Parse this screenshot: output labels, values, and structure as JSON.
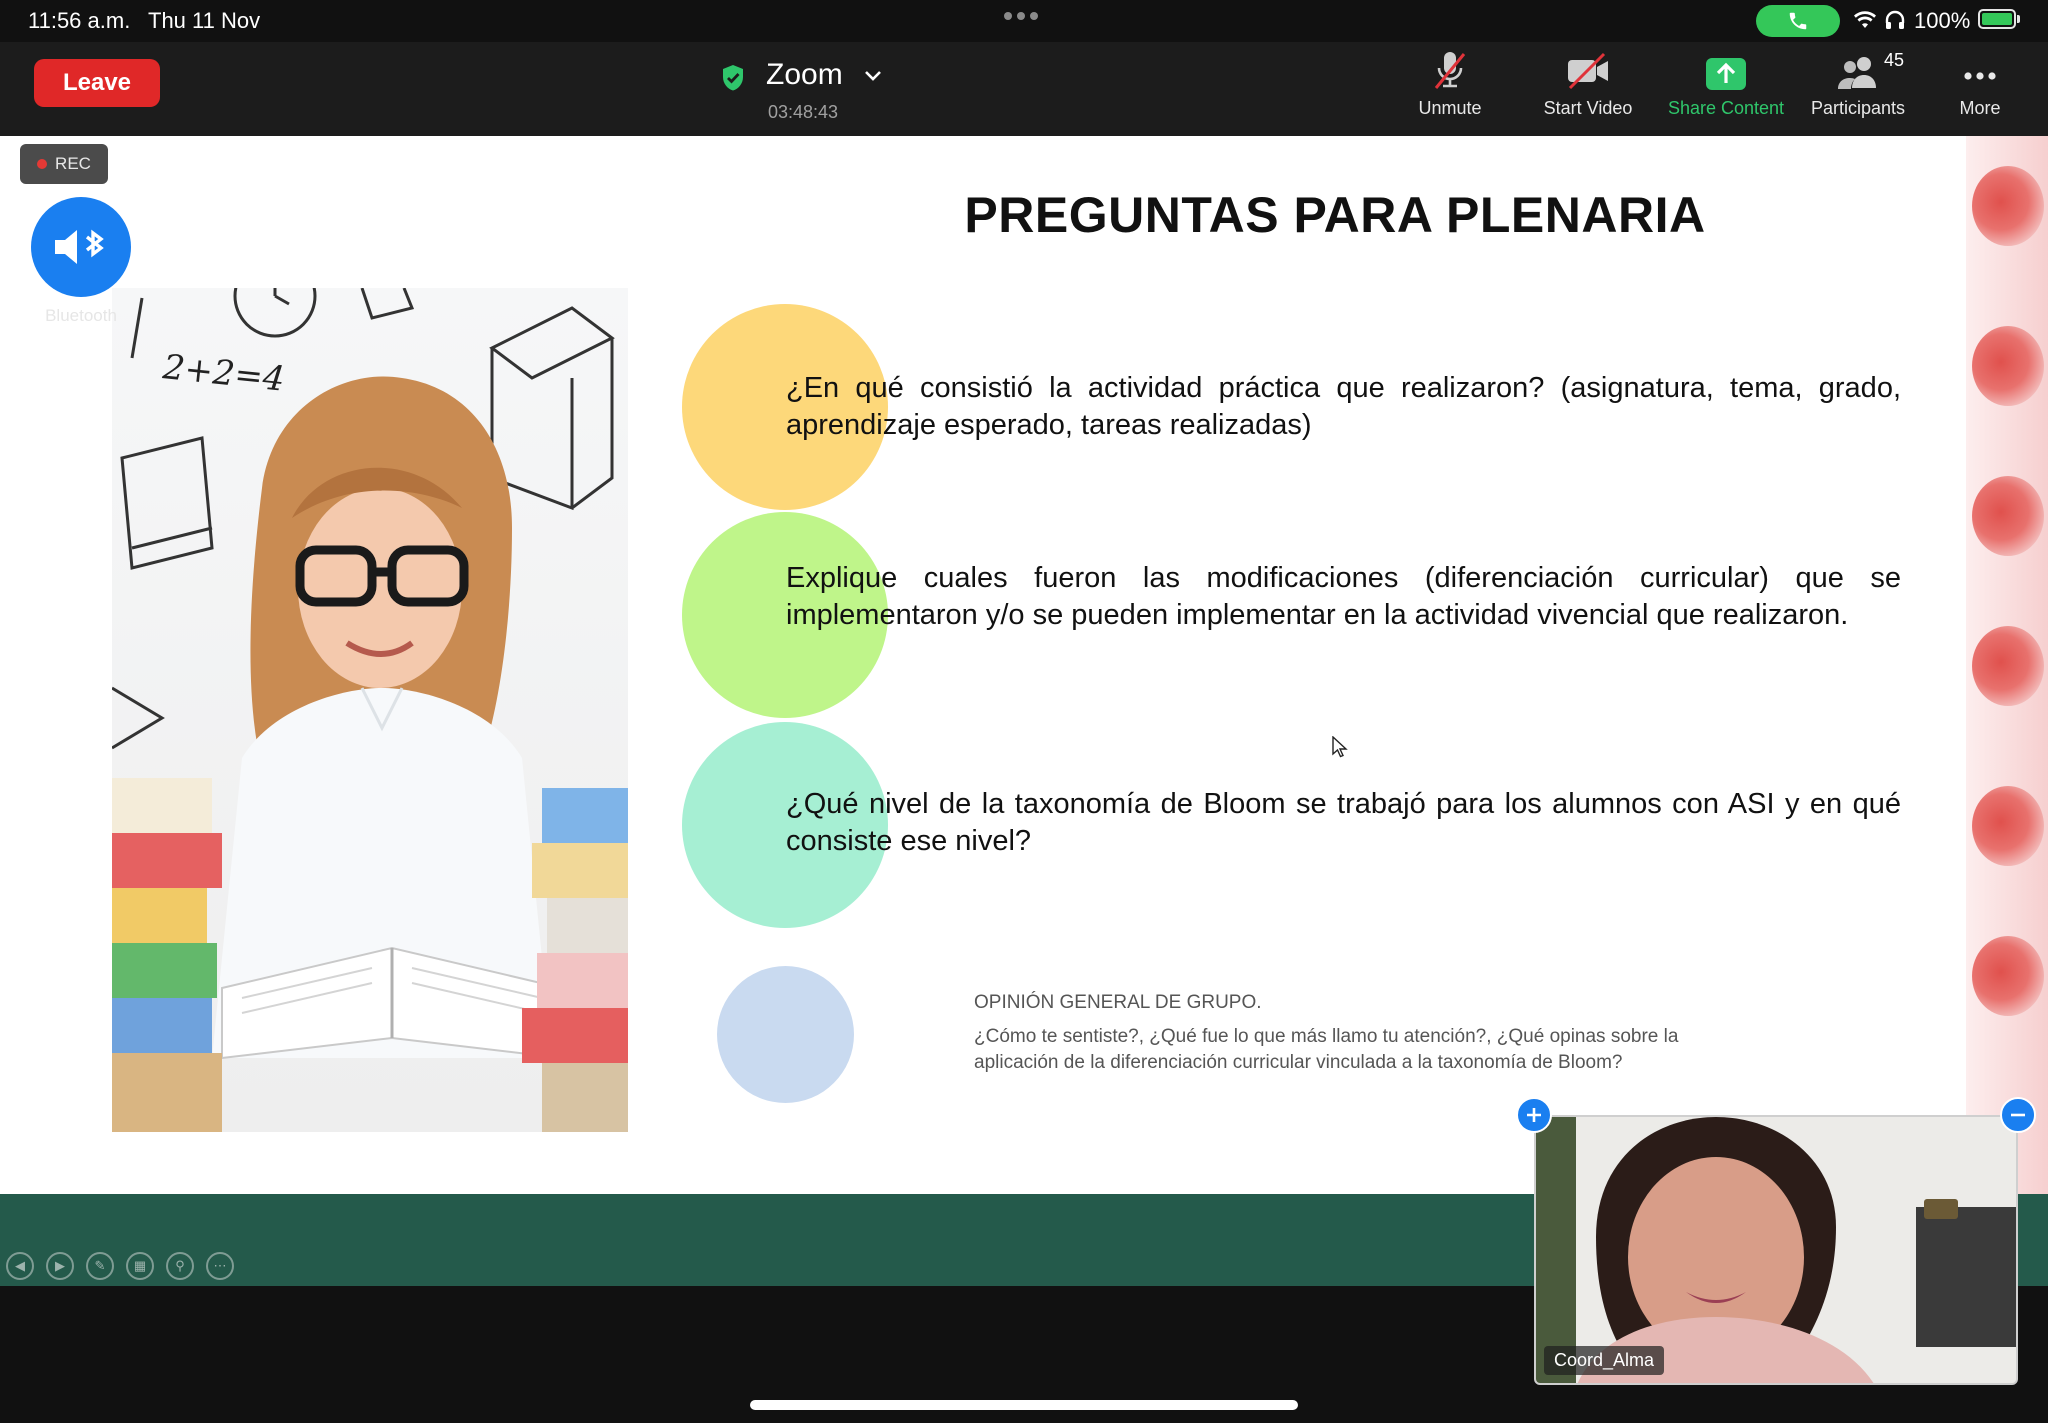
{
  "status_bar": {
    "time": "11:56 a.m.",
    "date": "Thu 11 Nov",
    "battery": "100%"
  },
  "toolbar": {
    "leave_label": "Leave",
    "meeting_title": "Zoom",
    "timer": "03:48:43",
    "unmute_label": "Unmute",
    "start_video_label": "Start Video",
    "share_label": "Share Content",
    "participants_label": "Participants",
    "participants_count": "45",
    "more_label": "More"
  },
  "recording": {
    "label": "REC"
  },
  "bluetooth": {
    "label": "Bluetooth"
  },
  "slide": {
    "title": "PREGUNTAS PARA PLENARIA",
    "photo_caption": "2+2=4",
    "questions": [
      {
        "text": "¿En qué consistió la actividad práctica que realizaron? (asignatura, tema, grado, aprendizaje esperado, tareas realizadas)",
        "color": "#fdd87a"
      },
      {
        "text": "Explique cuales fueron las modificaciones (diferenciación curricular) que se implementaron y/o se pueden implementar en la actividad vivencial que realizaron.",
        "color": "#bff58a"
      },
      {
        "text": "¿Qué nivel de la taxonomía de Bloom se trabajó para los alumnos con ASI y en qué consiste ese nivel?",
        "color": "#a6efd3"
      }
    ],
    "opinion": {
      "title": "OPINIÓN GENERAL DE GRUPO.",
      "body": "¿Cómo te sentiste?, ¿Qué fue lo que más llamo tu atención?, ¿Qué opinas sobre la aplicación de la diferenciación curricular vinculada a la taxonomía de Bloom?",
      "color": "#c9daf0"
    }
  },
  "video": {
    "participant_name": "Coord_Alma"
  },
  "colors": {
    "leave": "#e02828",
    "share_green": "#2fc66b",
    "accent_blue": "#1a7ff0",
    "strip": "#245a4b"
  }
}
